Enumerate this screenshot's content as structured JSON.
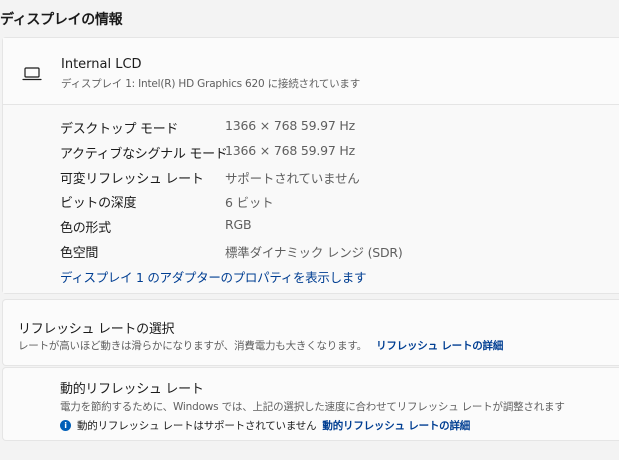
{
  "section_title": "ディスプレイの情報",
  "display": {
    "name": "Internal LCD",
    "subtitle": "ディスプレイ 1: Intel(R) HD Graphics 620 に接続されています",
    "properties": [
      {
        "label": "デスクトップ モード",
        "value": "1366 × 768 59.97 Hz"
      },
      {
        "label": "アクティブなシグナル モード",
        "value": "1366 × 768 59.97 Hz"
      },
      {
        "label": "可変リフレッシュ レート",
        "value": "サポートされていません"
      },
      {
        "label": "ビットの深度",
        "value": "6 ビット"
      },
      {
        "label": "色の形式",
        "value": "RGB"
      },
      {
        "label": "色空間",
        "value": "標準ダイナミック レンジ (SDR)"
      }
    ],
    "adapter_link": "ディスプレイ 1 のアダプターのプロパティを表示します"
  },
  "refresh": {
    "title": "リフレッシュ レートの選択",
    "desc": "レートが高いほど動きは滑らかになりますが、消費電力も大きくなります。",
    "link": "リフレッシュ レートの詳細"
  },
  "dynamic": {
    "title": "動的リフレッシュ レート",
    "desc": "電力を節約するために、Windows では、上記の選択した速度に合わせてリフレッシュ レートが調整されます",
    "note": "動的リフレッシュ レートはサポートされていません",
    "link": "動的リフレッシュ レートの詳細"
  }
}
